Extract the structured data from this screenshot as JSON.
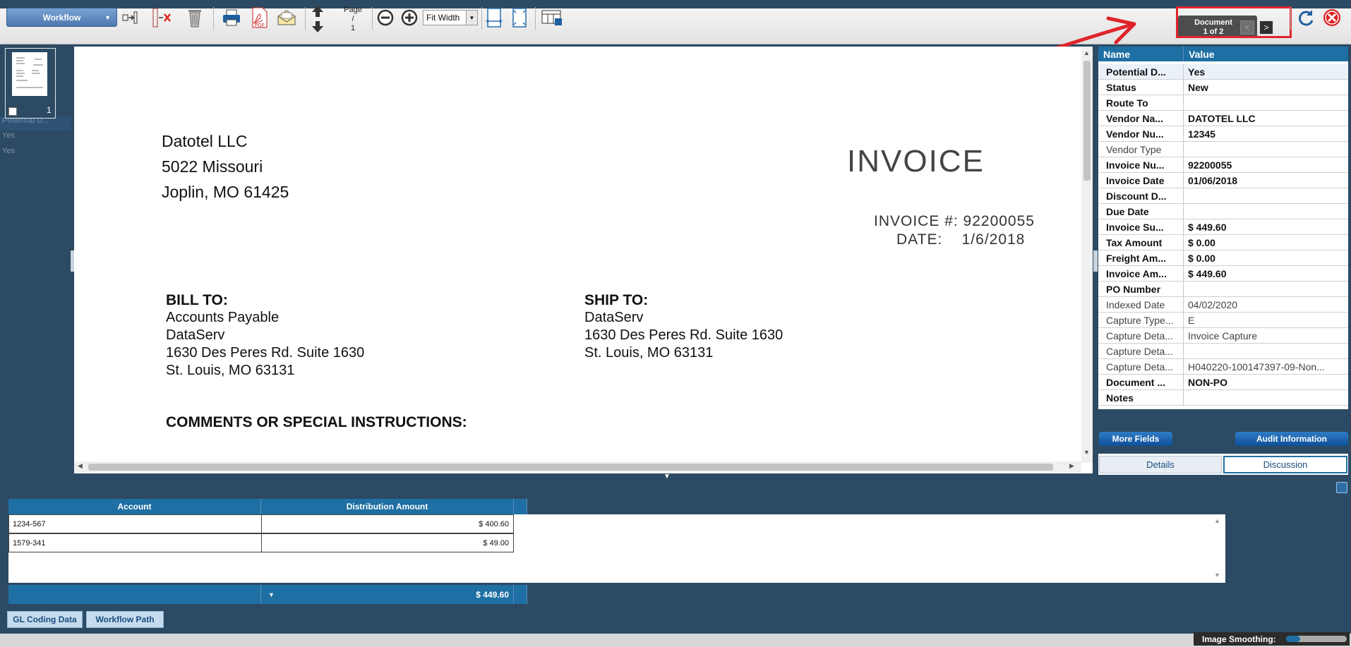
{
  "toolbar": {
    "workflow_label": "Workflow",
    "page_label": "Page",
    "page_sep": "/",
    "page_current": "1",
    "zoom_select": "Fit Width",
    "document_label": "Document",
    "document_position": "1 of 2",
    "prev_label": "<",
    "next_label": ">"
  },
  "thumbnails": [
    {
      "number": "1"
    }
  ],
  "left_list": {
    "header": "Potential D...",
    "rows": [
      "Yes",
      "Yes"
    ]
  },
  "document": {
    "vendor_lines": [
      "Datotel LLC",
      "5022 Missouri",
      "Joplin, MO 61425"
    ],
    "title": "INVOICE",
    "invoice_number_line": "INVOICE #: 92200055",
    "date_line": "DATE:    1/6/2018",
    "bill_to_heading": "BILL TO:",
    "bill_to_lines": [
      "Accounts Payable",
      "DataServ",
      "1630 Des Peres Rd. Suite 1630",
      "St. Louis, MO 63131"
    ],
    "ship_to_heading": "SHIP TO:",
    "ship_to_lines": [
      "DataServ",
      "1630 Des Peres Rd. Suite 1630",
      "St. Louis, MO 63131"
    ],
    "comments_heading": "COMMENTS OR SPECIAL INSTRUCTIONS:"
  },
  "properties": {
    "header_name": "Name",
    "header_value": "Value",
    "rows": [
      {
        "name": "Potential D...",
        "value": "Yes"
      },
      {
        "name": "Status",
        "value": "New"
      },
      {
        "name": "Route To",
        "value": ""
      },
      {
        "name": "Vendor Na...",
        "value": "DATOTEL LLC"
      },
      {
        "name": "Vendor Nu...",
        "value": "12345"
      },
      {
        "name": "Vendor Type",
        "value": ""
      },
      {
        "name": "Invoice Nu...",
        "value": "92200055"
      },
      {
        "name": "Invoice Date",
        "value": "01/06/2018"
      },
      {
        "name": "Discount D...",
        "value": ""
      },
      {
        "name": "Due Date",
        "value": ""
      },
      {
        "name": "Invoice Su...",
        "value": "$ 449.60"
      },
      {
        "name": "Tax Amount",
        "value": "$ 0.00"
      },
      {
        "name": "Freight Am...",
        "value": "$ 0.00"
      },
      {
        "name": "Invoice Am...",
        "value": "$ 449.60"
      },
      {
        "name": "PO Number",
        "value": ""
      },
      {
        "name": "Indexed Date",
        "value": "04/02/2020"
      },
      {
        "name": "Capture Type...",
        "value": "E"
      },
      {
        "name": "Capture Deta...",
        "value": "Invoice Capture"
      },
      {
        "name": "Capture Deta...",
        "value": ""
      },
      {
        "name": "Capture Deta...",
        "value": "H040220-100147397-09-Non..."
      },
      {
        "name": "Document ...",
        "value": "NON-PO"
      },
      {
        "name": "Notes",
        "value": ""
      }
    ],
    "more_fields_label": "More Fields",
    "audit_label": "Audit Information",
    "tab_details": "Details",
    "tab_discussion": "Discussion"
  },
  "gl": {
    "col_account": "Account",
    "col_amount": "Distribution Amount",
    "rows": [
      {
        "account": "1234-567",
        "amount": "$ 400.60"
      },
      {
        "account": "1579-341",
        "amount": "$ 49.00"
      }
    ],
    "total": "$ 449.60"
  },
  "bottom_tabs": {
    "gl_coding": "GL Coding Data",
    "workflow_path": "Workflow Path"
  },
  "status": {
    "image_smoothing_label": "Image Smoothing:"
  },
  "colors": {
    "header_blue": "#1e6fa3",
    "app_background": "#2c4a63",
    "annotation_red": "#e0242c"
  }
}
